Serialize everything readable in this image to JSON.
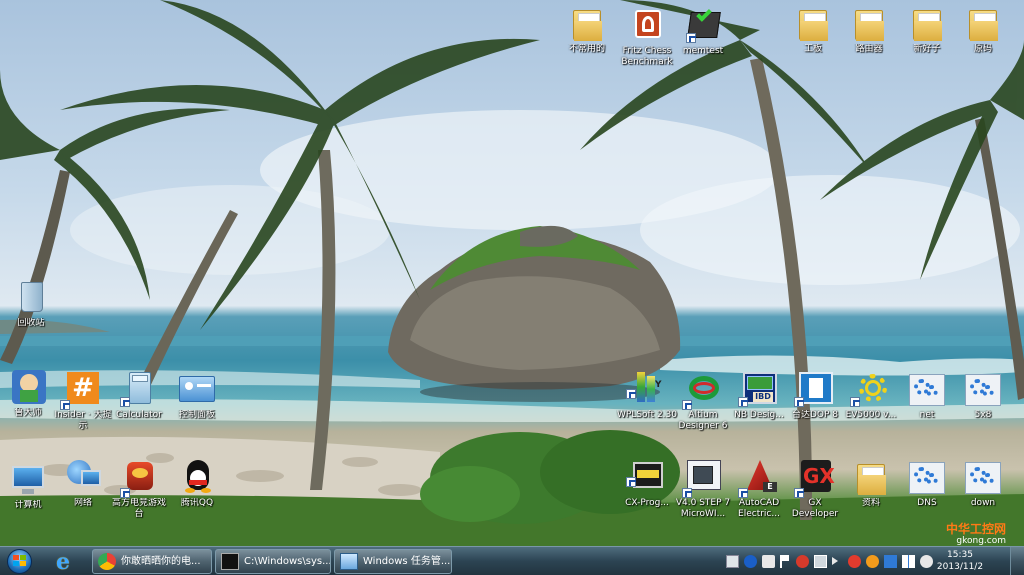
{
  "desktop": {
    "icons": [
      {
        "id": "recycle-bin",
        "label": "回收站",
        "icon": "recycle-bin-icon"
      },
      {
        "id": "bujiyong",
        "label": "不常用的",
        "icon": "folder-icon"
      },
      {
        "id": "fritz",
        "label": "Fritz Chess Benchmark",
        "icon": "fritz-chess-icon"
      },
      {
        "id": "memtest",
        "label": "memtest",
        "icon": "memtest-icon"
      },
      {
        "id": "gongban",
        "label": "工板",
        "icon": "folder-icon"
      },
      {
        "id": "luyouqi",
        "label": "路由器",
        "icon": "folder-icon"
      },
      {
        "id": "xinhaozi",
        "label": "新好子",
        "icon": "folder-icon"
      },
      {
        "id": "yuanma",
        "label": "原码",
        "icon": "folder-icon"
      },
      {
        "id": "lusuoji",
        "label": "鲁大师",
        "icon": "ludashi-icon"
      },
      {
        "id": "insider",
        "label": "Insider · 大提示",
        "icon": "insider-icon"
      },
      {
        "id": "calculator",
        "label": "Calculator",
        "icon": "calculator-icon"
      },
      {
        "id": "control-panel",
        "label": "控制面板",
        "icon": "control-panel-icon"
      },
      {
        "id": "wplsoft",
        "label": "WPLSoft 2.30",
        "icon": "wplsoft-icon"
      },
      {
        "id": "altium",
        "label": "Altium Designer 6",
        "icon": "altium-icon"
      },
      {
        "id": "nbdesign",
        "label": "NB Desig...",
        "icon": "nb-designer-icon"
      },
      {
        "id": "dop",
        "label": "台达DOP 8",
        "icon": "dop-icon"
      },
      {
        "id": "ev5000",
        "label": "EV5000 v...",
        "icon": "ev5000-icon"
      },
      {
        "id": "net",
        "label": "net",
        "icon": "network-config-icon"
      },
      {
        "id": "xuan",
        "label": "5x8",
        "icon": "network-config-icon"
      },
      {
        "id": "computer",
        "label": "计算机",
        "icon": "computer-icon"
      },
      {
        "id": "network",
        "label": "网络",
        "icon": "network-icon"
      },
      {
        "id": "gongfang",
        "label": "高方电竞游戏台",
        "icon": "game-icon"
      },
      {
        "id": "qq",
        "label": "腾讯QQ",
        "icon": "qq-penguin-icon"
      },
      {
        "id": "cxprog",
        "label": "CX-Prog...",
        "icon": "cx-programmer-icon"
      },
      {
        "id": "step7",
        "label": "V4.0 STEP 7 MicroWI...",
        "icon": "step7-icon"
      },
      {
        "id": "autocad",
        "label": "AutoCAD Electric...",
        "icon": "autocad-icon"
      },
      {
        "id": "gx",
        "label": "GX Developer",
        "icon": "gx-developer-icon"
      },
      {
        "id": "ziliao",
        "label": "资料",
        "icon": "folder-icon"
      },
      {
        "id": "dns",
        "label": "DNS",
        "icon": "network-config-icon"
      },
      {
        "id": "down",
        "label": "down",
        "icon": "network-config-icon"
      }
    ],
    "watermark_line1": "中华工控网",
    "watermark_line2": "gkong.com"
  },
  "taskbar": {
    "start_label": "Start",
    "tasks": [
      {
        "label": "你敢晒晒你的电...",
        "icon": "browser-icon"
      },
      {
        "label": "C:\\Windows\\sys...",
        "icon": "cmd-icon"
      },
      {
        "label": "Windows 任务管...",
        "icon": "task-manager-icon"
      }
    ],
    "clock_time": "15:35",
    "clock_date": "2013/11/2"
  },
  "colors": {
    "taskbar_dark": "#22343f",
    "label_shadow": "#000000",
    "watermark_orange": "#ff7a16"
  }
}
